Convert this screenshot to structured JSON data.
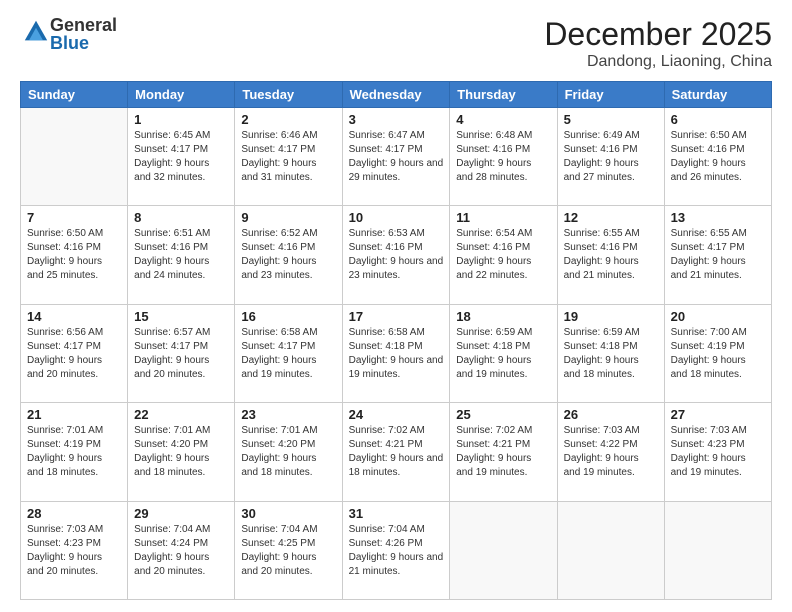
{
  "logo": {
    "general": "General",
    "blue": "Blue"
  },
  "header": {
    "month": "December 2025",
    "location": "Dandong, Liaoning, China"
  },
  "weekdays": [
    "Sunday",
    "Monday",
    "Tuesday",
    "Wednesday",
    "Thursday",
    "Friday",
    "Saturday"
  ],
  "weeks": [
    [
      {
        "day": "",
        "sunrise": "",
        "sunset": "",
        "daylight": ""
      },
      {
        "day": "1",
        "sunrise": "Sunrise: 6:45 AM",
        "sunset": "Sunset: 4:17 PM",
        "daylight": "Daylight: 9 hours and 32 minutes."
      },
      {
        "day": "2",
        "sunrise": "Sunrise: 6:46 AM",
        "sunset": "Sunset: 4:17 PM",
        "daylight": "Daylight: 9 hours and 31 minutes."
      },
      {
        "day": "3",
        "sunrise": "Sunrise: 6:47 AM",
        "sunset": "Sunset: 4:17 PM",
        "daylight": "Daylight: 9 hours and 29 minutes."
      },
      {
        "day": "4",
        "sunrise": "Sunrise: 6:48 AM",
        "sunset": "Sunset: 4:16 PM",
        "daylight": "Daylight: 9 hours and 28 minutes."
      },
      {
        "day": "5",
        "sunrise": "Sunrise: 6:49 AM",
        "sunset": "Sunset: 4:16 PM",
        "daylight": "Daylight: 9 hours and 27 minutes."
      },
      {
        "day": "6",
        "sunrise": "Sunrise: 6:50 AM",
        "sunset": "Sunset: 4:16 PM",
        "daylight": "Daylight: 9 hours and 26 minutes."
      }
    ],
    [
      {
        "day": "7",
        "sunrise": "Sunrise: 6:50 AM",
        "sunset": "Sunset: 4:16 PM",
        "daylight": "Daylight: 9 hours and 25 minutes."
      },
      {
        "day": "8",
        "sunrise": "Sunrise: 6:51 AM",
        "sunset": "Sunset: 4:16 PM",
        "daylight": "Daylight: 9 hours and 24 minutes."
      },
      {
        "day": "9",
        "sunrise": "Sunrise: 6:52 AM",
        "sunset": "Sunset: 4:16 PM",
        "daylight": "Daylight: 9 hours and 23 minutes."
      },
      {
        "day": "10",
        "sunrise": "Sunrise: 6:53 AM",
        "sunset": "Sunset: 4:16 PM",
        "daylight": "Daylight: 9 hours and 23 minutes."
      },
      {
        "day": "11",
        "sunrise": "Sunrise: 6:54 AM",
        "sunset": "Sunset: 4:16 PM",
        "daylight": "Daylight: 9 hours and 22 minutes."
      },
      {
        "day": "12",
        "sunrise": "Sunrise: 6:55 AM",
        "sunset": "Sunset: 4:16 PM",
        "daylight": "Daylight: 9 hours and 21 minutes."
      },
      {
        "day": "13",
        "sunrise": "Sunrise: 6:55 AM",
        "sunset": "Sunset: 4:17 PM",
        "daylight": "Daylight: 9 hours and 21 minutes."
      }
    ],
    [
      {
        "day": "14",
        "sunrise": "Sunrise: 6:56 AM",
        "sunset": "Sunset: 4:17 PM",
        "daylight": "Daylight: 9 hours and 20 minutes."
      },
      {
        "day": "15",
        "sunrise": "Sunrise: 6:57 AM",
        "sunset": "Sunset: 4:17 PM",
        "daylight": "Daylight: 9 hours and 20 minutes."
      },
      {
        "day": "16",
        "sunrise": "Sunrise: 6:58 AM",
        "sunset": "Sunset: 4:17 PM",
        "daylight": "Daylight: 9 hours and 19 minutes."
      },
      {
        "day": "17",
        "sunrise": "Sunrise: 6:58 AM",
        "sunset": "Sunset: 4:18 PM",
        "daylight": "Daylight: 9 hours and 19 minutes."
      },
      {
        "day": "18",
        "sunrise": "Sunrise: 6:59 AM",
        "sunset": "Sunset: 4:18 PM",
        "daylight": "Daylight: 9 hours and 19 minutes."
      },
      {
        "day": "19",
        "sunrise": "Sunrise: 6:59 AM",
        "sunset": "Sunset: 4:18 PM",
        "daylight": "Daylight: 9 hours and 18 minutes."
      },
      {
        "day": "20",
        "sunrise": "Sunrise: 7:00 AM",
        "sunset": "Sunset: 4:19 PM",
        "daylight": "Daylight: 9 hours and 18 minutes."
      }
    ],
    [
      {
        "day": "21",
        "sunrise": "Sunrise: 7:01 AM",
        "sunset": "Sunset: 4:19 PM",
        "daylight": "Daylight: 9 hours and 18 minutes."
      },
      {
        "day": "22",
        "sunrise": "Sunrise: 7:01 AM",
        "sunset": "Sunset: 4:20 PM",
        "daylight": "Daylight: 9 hours and 18 minutes."
      },
      {
        "day": "23",
        "sunrise": "Sunrise: 7:01 AM",
        "sunset": "Sunset: 4:20 PM",
        "daylight": "Daylight: 9 hours and 18 minutes."
      },
      {
        "day": "24",
        "sunrise": "Sunrise: 7:02 AM",
        "sunset": "Sunset: 4:21 PM",
        "daylight": "Daylight: 9 hours and 18 minutes."
      },
      {
        "day": "25",
        "sunrise": "Sunrise: 7:02 AM",
        "sunset": "Sunset: 4:21 PM",
        "daylight": "Daylight: 9 hours and 19 minutes."
      },
      {
        "day": "26",
        "sunrise": "Sunrise: 7:03 AM",
        "sunset": "Sunset: 4:22 PM",
        "daylight": "Daylight: 9 hours and 19 minutes."
      },
      {
        "day": "27",
        "sunrise": "Sunrise: 7:03 AM",
        "sunset": "Sunset: 4:23 PM",
        "daylight": "Daylight: 9 hours and 19 minutes."
      }
    ],
    [
      {
        "day": "28",
        "sunrise": "Sunrise: 7:03 AM",
        "sunset": "Sunset: 4:23 PM",
        "daylight": "Daylight: 9 hours and 20 minutes."
      },
      {
        "day": "29",
        "sunrise": "Sunrise: 7:04 AM",
        "sunset": "Sunset: 4:24 PM",
        "daylight": "Daylight: 9 hours and 20 minutes."
      },
      {
        "day": "30",
        "sunrise": "Sunrise: 7:04 AM",
        "sunset": "Sunset: 4:25 PM",
        "daylight": "Daylight: 9 hours and 20 minutes."
      },
      {
        "day": "31",
        "sunrise": "Sunrise: 7:04 AM",
        "sunset": "Sunset: 4:26 PM",
        "daylight": "Daylight: 9 hours and 21 minutes."
      },
      {
        "day": "",
        "sunrise": "",
        "sunset": "",
        "daylight": ""
      },
      {
        "day": "",
        "sunrise": "",
        "sunset": "",
        "daylight": ""
      },
      {
        "day": "",
        "sunrise": "",
        "sunset": "",
        "daylight": ""
      }
    ]
  ]
}
